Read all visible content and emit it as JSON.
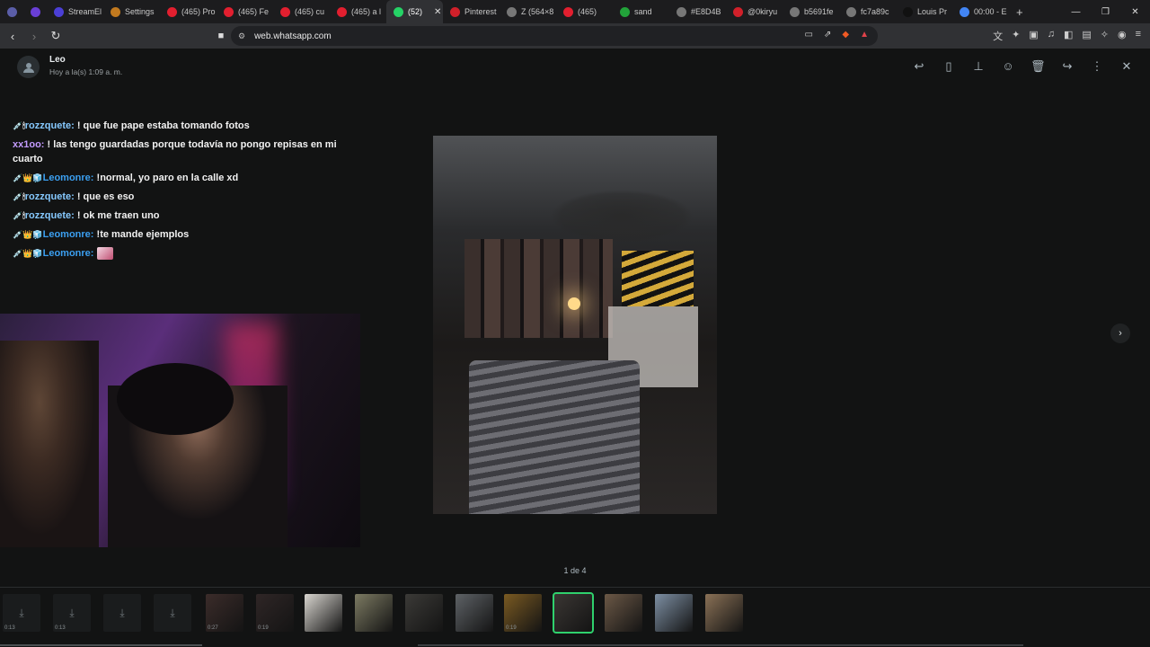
{
  "browser": {
    "tabs": [
      {
        "label": "",
        "color": "#5b5ea8"
      },
      {
        "label": "",
        "color": "#6a3fd6"
      },
      {
        "label": "StreamEl",
        "color": "#4b3fd6"
      },
      {
        "label": "Settings",
        "color": "#c27a1f"
      },
      {
        "label": "(465) Pro",
        "color": "#e21f2f"
      },
      {
        "label": "(465) Fe",
        "color": "#e21f2f"
      },
      {
        "label": "(465) cu",
        "color": "#e21f2f"
      },
      {
        "label": "(465) a l",
        "color": "#e21f2f"
      },
      {
        "label": "(52)",
        "color": "#25d366",
        "active": true
      },
      {
        "label": "Pinterest",
        "color": "#d1202a"
      },
      {
        "label": "Z (564×8",
        "color": "#777777"
      },
      {
        "label": "(465)",
        "color": "#e21f2f"
      },
      {
        "label": "sand",
        "color": "#22a33a"
      },
      {
        "label": "#E8D4B",
        "color": "#777777"
      },
      {
        "label": "@0kiryu",
        "color": "#d1202a"
      },
      {
        "label": "b5691fe",
        "color": "#777777"
      },
      {
        "label": "fc7a89c",
        "color": "#777777"
      },
      {
        "label": "Louis Pr",
        "color": "#111111"
      },
      {
        "label": "00:00 - E",
        "color": "#4285f4"
      }
    ],
    "url": "web.whatsapp.com"
  },
  "viewer": {
    "sender": "Leo",
    "timestamp": "Hoy a la(s) 1:09 a. m.",
    "counter": "1 de 4",
    "next_icon": "chevron-right-icon",
    "action_icons": [
      "reply-icon",
      "bookmark-icon",
      "pin-icon",
      "emoji-icon",
      "delete-icon",
      "forward-icon",
      "more-icon",
      "close-icon"
    ]
  },
  "chat": [
    {
      "badges": "💉🕯",
      "user": "rozzquete:",
      "text": " ! que fue pape estaba tomando fotos",
      "color": "u1"
    },
    {
      "badges": "",
      "user": "xx1oo:",
      "text": " ! las tengo guardadas porque todavía no pongo repisas en mi cuarto",
      "color": "u2"
    },
    {
      "badges": "💉👑🧊",
      "user": "Leomonre:",
      "text": " !normal, yo paro en la calle xd",
      "color": "u3"
    },
    {
      "badges": "💉🕯",
      "user": "rozzquete:",
      "text": " ! que es eso",
      "color": "u1"
    },
    {
      "badges": "💉🕯",
      "user": "rozzquete:",
      "text": " ! ok me traen uno",
      "color": "u1"
    },
    {
      "badges": "💉👑🧊",
      "user": "Leomonre:",
      "text": " !te mande ejemplos",
      "color": "u3"
    },
    {
      "badges": "💉👑🧊",
      "user": "Leomonre:",
      "text": " ",
      "color": "u3",
      "sticker": true
    }
  ],
  "thumbnails": [
    {
      "kind": "download",
      "duration": "0:13"
    },
    {
      "kind": "download",
      "duration": "0:13"
    },
    {
      "kind": "download",
      "duration": ""
    },
    {
      "kind": "download",
      "duration": ""
    },
    {
      "kind": "image",
      "duration": "0:27",
      "color": "#3b2c2a"
    },
    {
      "kind": "image",
      "duration": "0:19",
      "color": "#2f2626"
    },
    {
      "kind": "image",
      "duration": "",
      "color": "#d9d6d0"
    },
    {
      "kind": "image",
      "duration": "",
      "color": "#7c7a62"
    },
    {
      "kind": "image",
      "duration": "",
      "color": "#3b3a37"
    },
    {
      "kind": "image",
      "duration": "",
      "color": "#5e6266"
    },
    {
      "kind": "image",
      "duration": "0:19",
      "color": "#7a5a22"
    },
    {
      "kind": "image",
      "duration": "",
      "color": "#3a3633",
      "selected": true
    },
    {
      "kind": "image",
      "duration": "",
      "color": "#6b5846"
    },
    {
      "kind": "image",
      "duration": "",
      "color": "#7d8fa3"
    },
    {
      "kind": "image",
      "duration": "",
      "color": "#8a7156"
    }
  ]
}
